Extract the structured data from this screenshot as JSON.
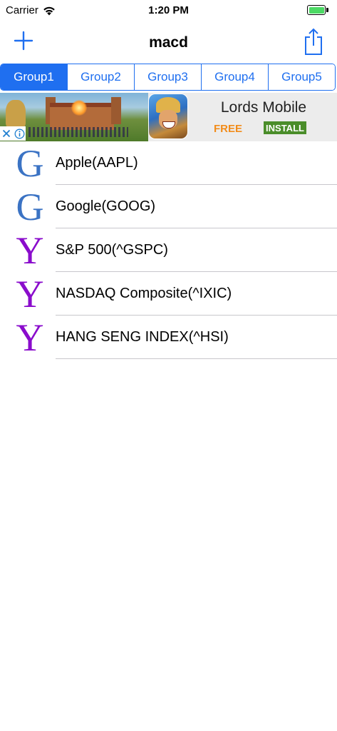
{
  "status_bar": {
    "carrier": "Carrier",
    "time": "1:20 PM",
    "battery_color": "#4cd964"
  },
  "nav": {
    "title": "macd",
    "add_icon": "plus-icon",
    "share_icon": "share-icon"
  },
  "segments": {
    "items": [
      "Group1",
      "Group2",
      "Group3",
      "Group4",
      "Group5"
    ],
    "selected": "Group1",
    "accent": "#1f6ff0"
  },
  "ad": {
    "title": "Lords Mobile",
    "price": "FREE",
    "install": "INSTALL"
  },
  "list": {
    "items": [
      {
        "icon": "G",
        "source": "google",
        "label": "Apple(AAPL)"
      },
      {
        "icon": "G",
        "source": "google",
        "label": "Google(GOOG)"
      },
      {
        "icon": "Y",
        "source": "yahoo",
        "label": "S&P 500(^GSPC)"
      },
      {
        "icon": "Y",
        "source": "yahoo",
        "label": "NASDAQ Composite(^IXIC)"
      },
      {
        "icon": "Y",
        "source": "yahoo",
        "label": "HANG SENG INDEX(^HSI)"
      }
    ],
    "google_color": "#3b73c4",
    "yahoo_color": "#8a0ccc"
  }
}
